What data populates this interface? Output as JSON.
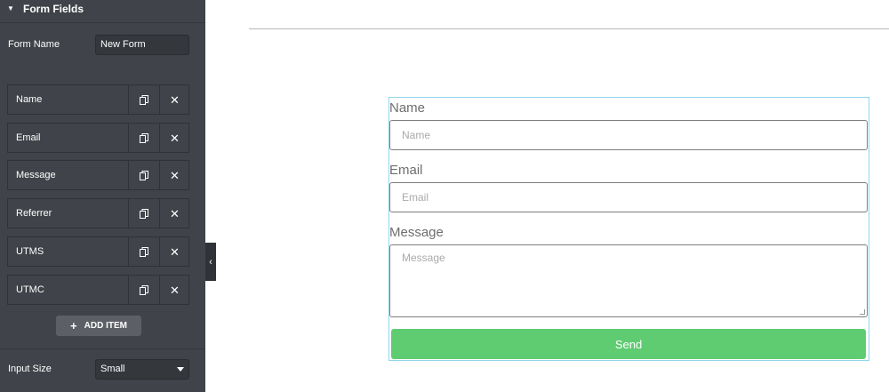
{
  "panel": {
    "section_title": "Form Fields",
    "form_name": {
      "label": "Form Name",
      "value": "New Form"
    },
    "items": [
      {
        "label": "Name"
      },
      {
        "label": "Email"
      },
      {
        "label": "Message"
      },
      {
        "label": "Referrer"
      },
      {
        "label": "UTMS"
      },
      {
        "label": "UTMC"
      }
    ],
    "add_item_label": "ADD ITEM",
    "input_size": {
      "label": "Input Size",
      "value": "Small"
    }
  },
  "form": {
    "fields": [
      {
        "label": "Name",
        "placeholder": "Name"
      },
      {
        "label": "Email",
        "placeholder": "Email"
      },
      {
        "label": "Message",
        "placeholder": "Message"
      }
    ],
    "submit_label": "Send"
  },
  "colors": {
    "panel_bg": "#404349",
    "submit_button": "#5fcc72",
    "widget_outline": "#8fd6ee"
  },
  "icons": {
    "duplicate": "copy-icon",
    "remove": "close-icon",
    "collapse": "chevron-left-icon"
  }
}
